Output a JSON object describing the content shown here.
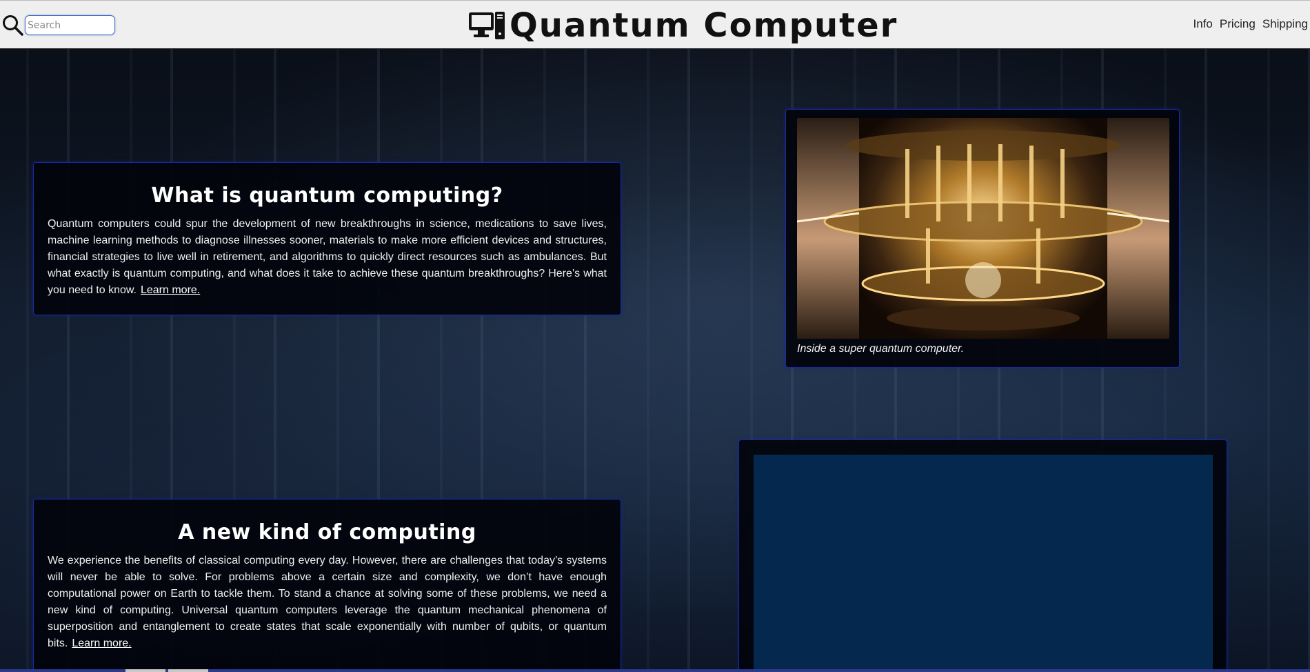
{
  "header": {
    "search_placeholder": "Search",
    "brand_title": "Quantum Computer",
    "nav": [
      "Info",
      "Pricing",
      "Shipping"
    ]
  },
  "sections": [
    {
      "heading": "What is quantum computing?",
      "body": "Quantum computers could spur the development of new breakthroughs in science, medications to save lives, machine learning methods to diagnose illnesses sooner, materials to make more efficient devices and structures, financial strategies to live well in retirement, and algorithms to quickly direct resources such as ambulances. But what exactly is quantum computing, and what does it take to achieve these quantum breakthroughs? Here’s what you need to know.",
      "link": "Learn more."
    },
    {
      "heading": "A new kind of computing",
      "body": "We experience the benefits of classical computing every day. However, there are challenges that today’s systems will never be able to solve. For problems above a certain size and complexity, we don’t have enough computational power on Earth to tackle them. To stand a chance at solving some of these problems, we need a new kind of computing. Universal quantum computers leverage the quantum mechanical phenomena of superposition and entanglement to create states that scale exponentially with number of qubits, or quantum bits.",
      "link": "Learn more."
    }
  ],
  "figure": {
    "caption": "Inside a super quantum computer."
  },
  "colors": {
    "accent_border": "#1a2aa0",
    "video_panel": "#04284e",
    "header_bg": "#efefef"
  }
}
